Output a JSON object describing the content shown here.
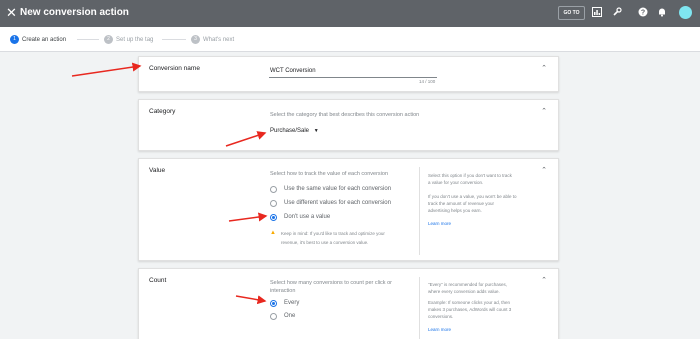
{
  "topbar": {
    "close_icon": "close-icon",
    "title": "New conversion action",
    "goto_label": "GO TO",
    "icons": [
      "chart-icon",
      "wrench-icon",
      "help-icon",
      "bell-icon"
    ],
    "bar_color": "#5f6368",
    "avatar_color": "#7fe5f0"
  },
  "stepper": {
    "steps": [
      {
        "num": "1",
        "label": "Create an action"
      },
      {
        "num": "2",
        "label": "Set up the tag"
      },
      {
        "num": "3",
        "label": "What's next"
      }
    ],
    "active_color": "#1a73e8"
  },
  "conversion_name": {
    "label": "Conversion name",
    "value": "WCT Conversion",
    "counter": "14 / 100"
  },
  "category": {
    "label": "Category",
    "description": "Select the category that best describes this conversion action",
    "selected": "Purchase/Sale"
  },
  "value": {
    "label": "Value",
    "description": "Select how to track the value of each conversion",
    "options": [
      "Use the same value for each conversion",
      "Use different values for each conversion",
      "Don't use a value"
    ],
    "selected_index": 2,
    "warning_line1": "Keep in mind: If you'd like to track and optimize your",
    "warning_line2": "revenue, it's best to use a conversion value.",
    "help_line1": "Select this option if you don't want to track",
    "help_line2": "a value for your conversion.",
    "help_line3": "If you don't use a value, you won't be able to",
    "help_line4": "track the amount of revenue your",
    "help_line5": "advertising helps you earn.",
    "learn_more": "Learn more"
  },
  "count": {
    "label": "Count",
    "description_line1": "Select how many conversions to count per click or",
    "description_line2": "interaction",
    "options": [
      "Every",
      "One"
    ],
    "selected_index": 0,
    "help_line1": "\"Every\" is recommended for purchases,",
    "help_line2": "where every conversion adds value.",
    "help_line3": "Example: If someone clicks your ad, then",
    "help_line4": "makes 3 purchases, AdWords will count 3",
    "help_line5": "conversions.",
    "learn_more": "Learn more"
  },
  "annotation_color": "#e8281f"
}
